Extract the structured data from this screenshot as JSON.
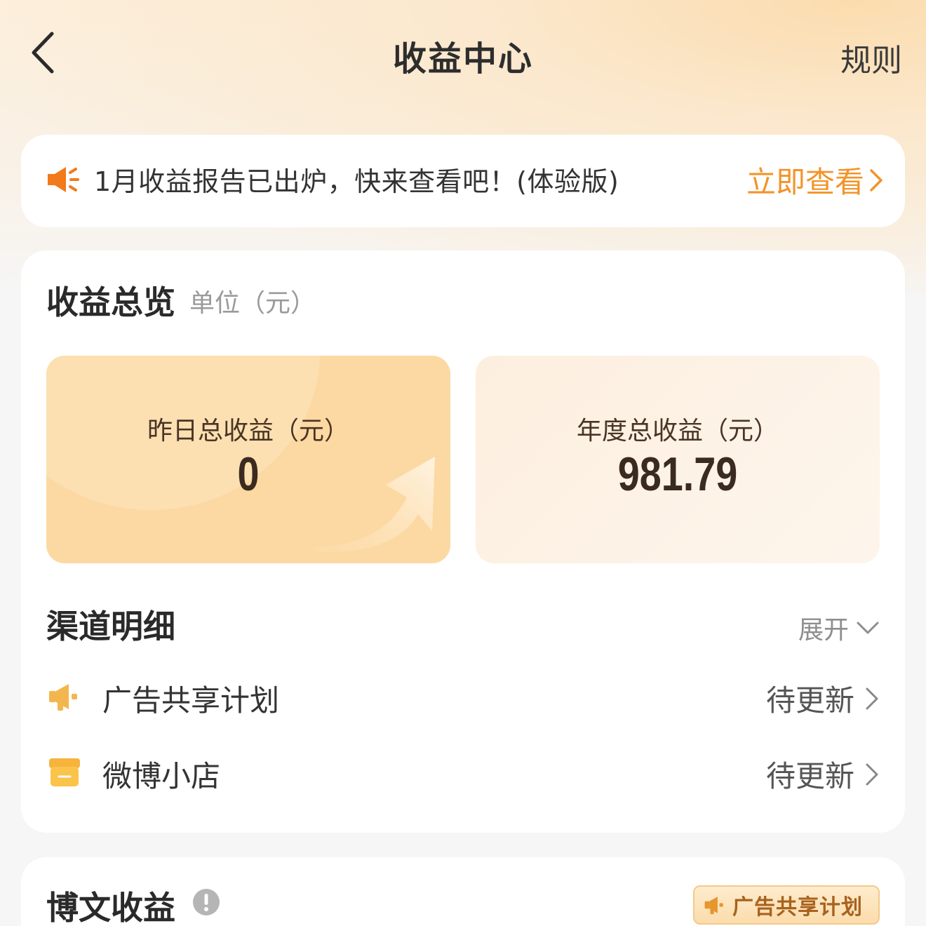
{
  "header": {
    "title": "收益中心",
    "rules_label": "规则"
  },
  "notice": {
    "text": "1月收益报告已出炉，快来查看吧！(体验版)",
    "action_label": "立即查看"
  },
  "overview": {
    "title": "收益总览",
    "unit": "单位（元）",
    "stats": [
      {
        "label": "昨日总收益（元）",
        "value": "0"
      },
      {
        "label": "年度总收益（元）",
        "value": "981.79"
      }
    ]
  },
  "channels": {
    "title": "渠道明细",
    "expand_label": "展开",
    "items": [
      {
        "name": "广告共享计划",
        "status": "待更新",
        "icon": "megaphone-icon"
      },
      {
        "name": "微博小店",
        "status": "待更新",
        "icon": "shop-icon"
      }
    ]
  },
  "post_income": {
    "title": "博文收益",
    "badge_label": "广告共享计划"
  },
  "colors": {
    "accent": "#f2942a",
    "stat_highlight_bg": "#fcd9a2",
    "stat_bg": "#fdf1e4",
    "badge_text": "#a8621d"
  }
}
